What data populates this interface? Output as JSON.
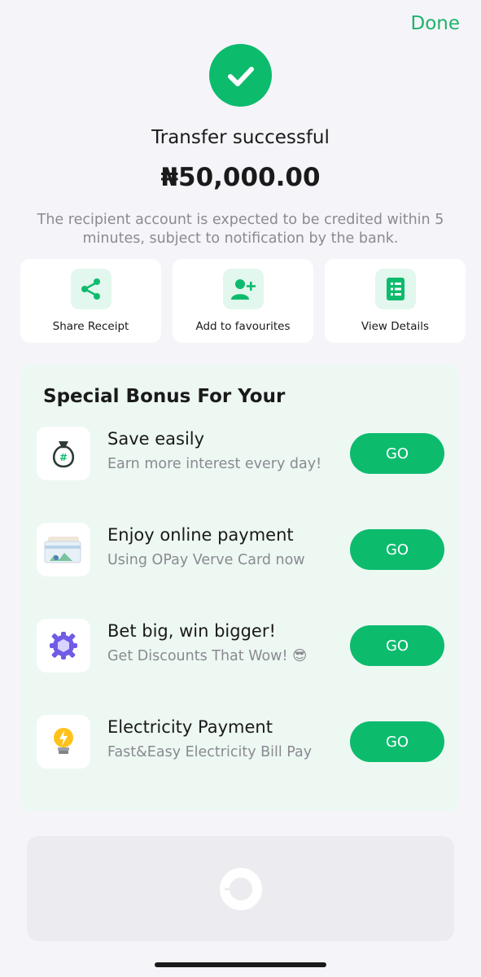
{
  "header": {
    "done_label": "Done"
  },
  "status": {
    "title": "Transfer successful",
    "amount": "₦50,000.00",
    "note": "The recipient account is expected to be credited within 5 minutes, subject to notification by the bank."
  },
  "actions": [
    {
      "label": "Share Receipt",
      "icon": "share-icon"
    },
    {
      "label": "Add to favourites",
      "icon": "add-user-icon"
    },
    {
      "label": "View Details",
      "icon": "document-icon"
    }
  ],
  "bonus": {
    "title": "Special Bonus For Your",
    "items": [
      {
        "name": "Save easily",
        "subtitle": "Earn more interest every day!",
        "button": "GO",
        "icon": "money-bag-icon"
      },
      {
        "name": "Enjoy online payment",
        "subtitle": "Using OPay Verve Card now",
        "button": "GO",
        "icon": "card-icon"
      },
      {
        "name": "Bet big, win bigger!",
        "subtitle": "Get Discounts That Wow! 😎",
        "button": "GO",
        "icon": "gear-icon"
      },
      {
        "name": "Electricity Payment",
        "subtitle": "Fast&Easy Electricity Bill Pay",
        "button": "GO",
        "icon": "lightbulb-icon"
      }
    ]
  },
  "colors": {
    "accent": "#0dbb6d",
    "accent_light": "#e2f7ed",
    "panel": "#edf8f2",
    "background": "#f5f5f9"
  }
}
